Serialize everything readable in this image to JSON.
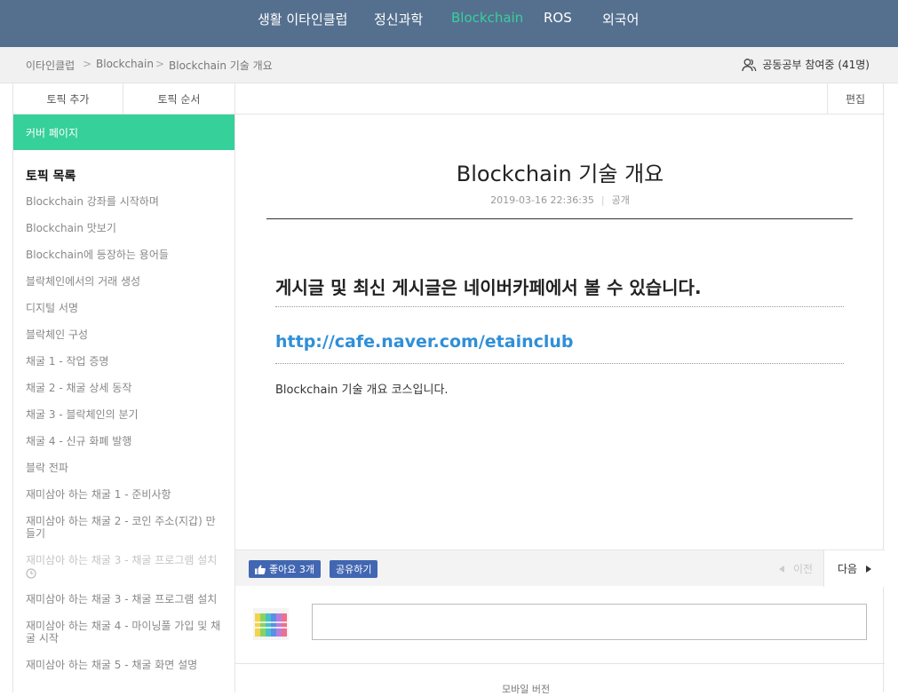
{
  "nav": {
    "items": [
      "생활 이타인클럽",
      "정신과학",
      "Blockchain",
      "ROS",
      "외국어"
    ],
    "active_index": 2
  },
  "breadcrumb": {
    "items": [
      "이타인클럽",
      "Blockchain",
      "Blockchain 기술 개요"
    ],
    "separator": ">"
  },
  "participants": {
    "label": "공동공부 참여중",
    "count": "(41명)",
    "icon": "users-icon"
  },
  "sidebar": {
    "add_topic": "토픽 추가",
    "topic_order": "토픽 순서",
    "cover_page": "커버 페이지",
    "toc_title": "토픽 목록",
    "items": [
      {
        "label": "Blockchain 강좌를 시작하며",
        "dim": false
      },
      {
        "label": "Blockchain 맛보기",
        "dim": false
      },
      {
        "label": "Blockchain에 등장하는 용어들",
        "dim": false
      },
      {
        "label": "블락체인에서의 거래 생성",
        "dim": false
      },
      {
        "label": "디지털 서명",
        "dim": false
      },
      {
        "label": "블락체인 구성",
        "dim": false
      },
      {
        "label": "채굴 1 - 작업 증명",
        "dim": false
      },
      {
        "label": "채굴 2 - 채굴 상세 동작",
        "dim": false
      },
      {
        "label": "채굴 3 - 블락체인의 분기",
        "dim": false
      },
      {
        "label": "채굴 4 - 신규 화폐 발행",
        "dim": false
      },
      {
        "label": "블락 전파",
        "dim": false
      },
      {
        "label": "재미삼아 하는 채굴 1 - 준비사항",
        "dim": false
      },
      {
        "label": "재미삼아 하는 채굴 2 - 코인 주소(지갑) 만들기",
        "dim": false
      },
      {
        "label": "재미삼아 하는 채굴 3 - 채굴 프로그램 설치",
        "dim": true,
        "icon": "clock-icon"
      },
      {
        "label": "재미삼아 하는 채굴 3 - 채굴 프로그램 설치",
        "dim": false
      },
      {
        "label": "재미삼아 하는 채굴 4 - 마이닝풀 가입 및 채굴 시작",
        "dim": false
      },
      {
        "label": "재미삼아 하는 채굴 5 - 채굴 화면 설명",
        "dim": false
      }
    ]
  },
  "post": {
    "edit": "편집",
    "title": "Blockchain 기술 개요",
    "date": "2019-03-16 22:36:35",
    "visibility": "공개",
    "headline": "게시글 및 최신 게시글은 네이버카페에서 볼 수 있습니다.",
    "link": "http://cafe.naver.com/etainclub",
    "body": "Blockchain 기술 개요 코스입니다."
  },
  "actions": {
    "like_label": "좋아요",
    "like_count": "3개",
    "share_label": "공유하기",
    "prev_label": "이전",
    "next_label": "다음",
    "accent_like": "#4267b2"
  },
  "footer": {
    "cut_text": "모바일 버전"
  },
  "colors": {
    "nav_bg": "#55708f",
    "accent": "#36d09a",
    "link": "#2f8fd8"
  }
}
